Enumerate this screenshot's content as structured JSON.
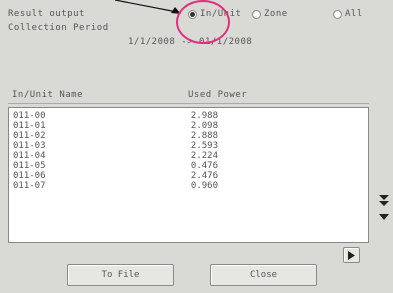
{
  "result_output_label": "Result output",
  "period_label": "Collection Period",
  "period_value": "1/1/2008 -> 01/1/2008",
  "radios": [
    {
      "label": "In/Unit",
      "selected": true
    },
    {
      "label": "Zone",
      "selected": false
    },
    {
      "label": "All",
      "selected": false
    }
  ],
  "columns": [
    "In/Unit Name",
    "Used Power"
  ],
  "rows": [
    {
      "name": "011-00",
      "value": "2.988"
    },
    {
      "name": "011-01",
      "value": "2.098"
    },
    {
      "name": "011-02",
      "value": "2.888"
    },
    {
      "name": "011-03",
      "value": "2.593"
    },
    {
      "name": "011-04",
      "value": "2.224"
    },
    {
      "name": "011-05",
      "value": "0.476"
    },
    {
      "name": "011-06",
      "value": "2.476"
    },
    {
      "name": "011-07",
      "value": "0.960"
    }
  ],
  "buttons": {
    "to_file": "To File",
    "close": "Close"
  },
  "icons": {
    "scroll_down": "double-down-arrow-icon",
    "scroll_one": "down-triangle-icon",
    "next": "right-triangle-icon",
    "pointer": "pointer-arrow-icon"
  }
}
